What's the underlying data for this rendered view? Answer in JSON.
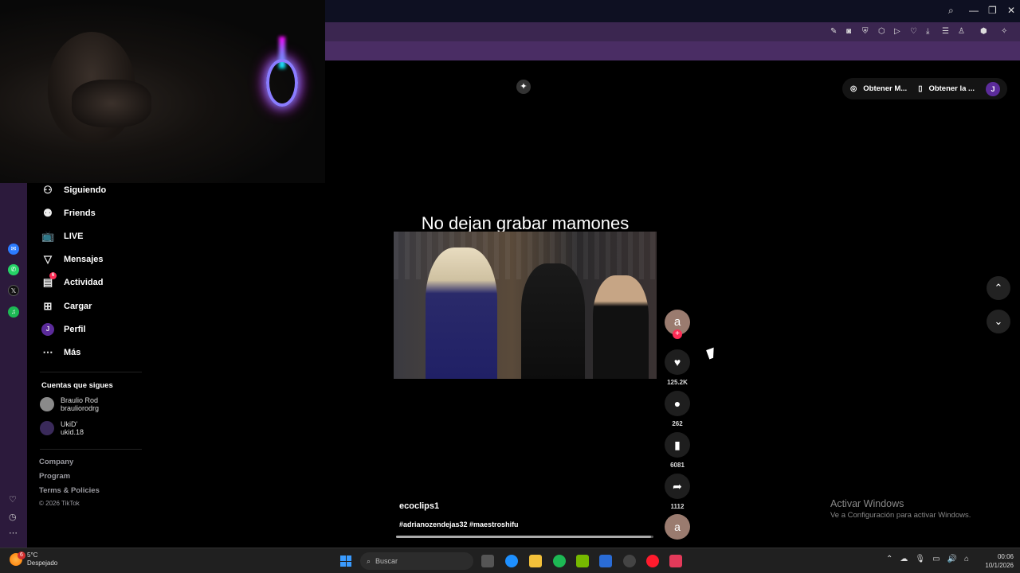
{
  "sidebar": {
    "items": [
      {
        "label": "Siguiendo",
        "icon": "person-follow-icon"
      },
      {
        "label": "Friends",
        "icon": "friends-icon"
      },
      {
        "label": "LIVE",
        "icon": "live-tv-icon"
      },
      {
        "label": "Mensajes",
        "icon": "send-icon"
      },
      {
        "label": "Actividad",
        "icon": "activity-icon",
        "badge": "6"
      },
      {
        "label": "Cargar",
        "icon": "plus-square-icon"
      },
      {
        "label": "Perfil",
        "icon": "avatar-J",
        "avatar_letter": "J"
      },
      {
        "label": "Más",
        "icon": "more-icon"
      }
    ],
    "following_title": "Cuentas que sigues",
    "following": [
      {
        "name": "Braulio Rod",
        "handle": "brauliorodrg"
      },
      {
        "name": "UkiD'",
        "handle": "ukid.18"
      }
    ],
    "footer": {
      "company": "Company",
      "program": "Program",
      "terms": "Terms & Policies",
      "copyright": "© 2026 TikTok"
    }
  },
  "video": {
    "caption": "No dejan grabar mamones",
    "username": "ecoclips1",
    "hashtags": "#adrianozendejas32 #maestroshifu",
    "author_avatar_letter": "a",
    "likes": "125.2K",
    "comments": "262",
    "saves": "6081",
    "shares": "1112",
    "progress": 0.99
  },
  "topright": {
    "get_coins": "Obtener M...",
    "get_app": "Obtener la ...",
    "avatar_letter": "J"
  },
  "windows_watermark": {
    "title": "Activar Windows",
    "subtitle": "Ve a Configuración para activar Windows."
  },
  "taskbar": {
    "weather_temp": "5°C",
    "weather_desc": "Despejado",
    "weather_badge": "6",
    "search_placeholder": "Buscar",
    "time": "00:06",
    "date": "10/1/2026"
  },
  "colors": {
    "accent": "#fe2c55",
    "browser_purple": "#4a2d64",
    "taskbar": "#202020"
  }
}
